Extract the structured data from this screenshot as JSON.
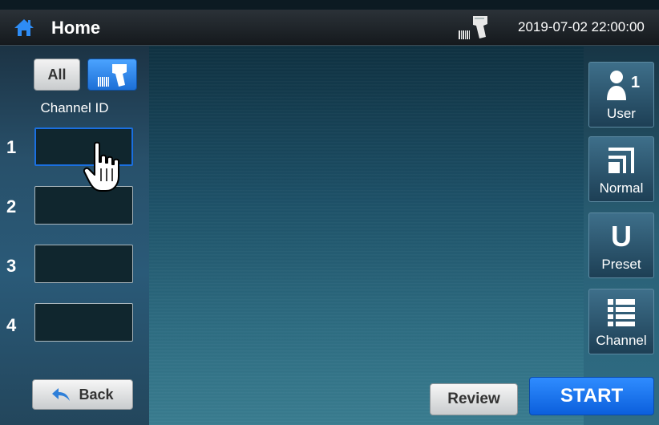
{
  "header": {
    "title": "Home",
    "datetime": "2019-07-02 22:00:00",
    "home_icon": "home-icon",
    "scanner_icon": "barcode-scanner-icon"
  },
  "left_panel": {
    "all_label": "All",
    "scan_icon": "barcode-scanner-icon",
    "channel_id_label": "Channel ID",
    "channels": [
      {
        "number": "1",
        "value": "",
        "active": true
      },
      {
        "number": "2",
        "value": "",
        "active": false
      },
      {
        "number": "3",
        "value": "",
        "active": false
      },
      {
        "number": "4",
        "value": "",
        "active": false
      }
    ],
    "back_label": "Back"
  },
  "right_panel": {
    "user_label": "User",
    "user_count": "1",
    "mode_label": "Normal",
    "preset_label": "Preset",
    "preset_letter": "U",
    "channel_label": "Channel"
  },
  "bottom": {
    "review_label": "Review",
    "start_label": "START"
  },
  "colors": {
    "accent": "#1a6fe0",
    "start_button": "#1f7cf0",
    "topbar": "#1e2429"
  }
}
